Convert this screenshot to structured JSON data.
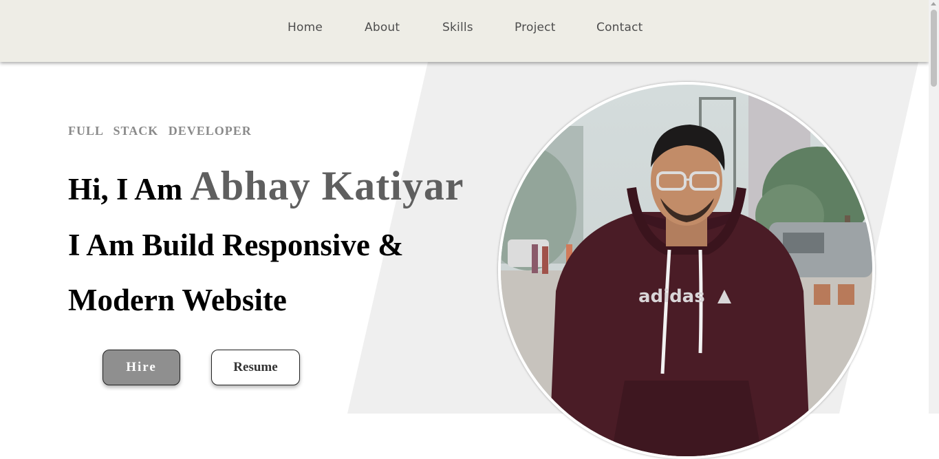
{
  "nav": {
    "items": [
      {
        "label": "Home"
      },
      {
        "label": "About"
      },
      {
        "label": "Skills"
      },
      {
        "label": "Project"
      },
      {
        "label": "Contact"
      }
    ]
  },
  "hero": {
    "subtitle": "FULL STACK DEVELOPER",
    "intro": "Hi, I Am ",
    "name": "Abhay Katiyar",
    "line2": "I Am Build Responsive &",
    "line3": "Modern Website",
    "hire_label": "Hire",
    "resume_label": "Resume"
  },
  "profile_photo": {
    "shirt_brand": "adidas"
  },
  "colors": {
    "navbar_bg": "#eeede6",
    "accent_grey": "#5f5f5f",
    "panel_bg": "#efefef",
    "hire_bg": "#8f8f8f"
  }
}
